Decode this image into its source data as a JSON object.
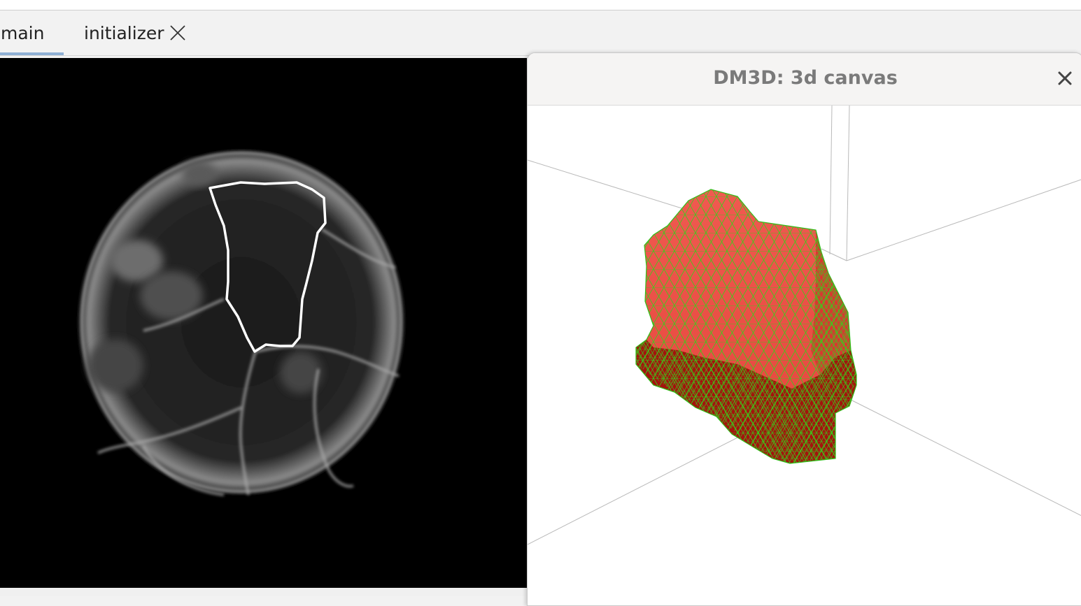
{
  "tabs": [
    {
      "label": "main",
      "active": true
    },
    {
      "label": "initializer",
      "active": false,
      "closable": true
    }
  ],
  "viewer": {
    "icons": {
      "close_tab": "close-x-icon"
    }
  },
  "window3d": {
    "title": "DM3D: 3d canvas",
    "close_icon": "close-icon",
    "mesh_color": "#e8463c",
    "mesh_shadow_color": "#a3140d",
    "wire_color": "#34d21a"
  },
  "colors": {
    "tab_underline": "#8fb0d4",
    "viewer_background": "#000000",
    "roi_outline": "#ffffff"
  }
}
